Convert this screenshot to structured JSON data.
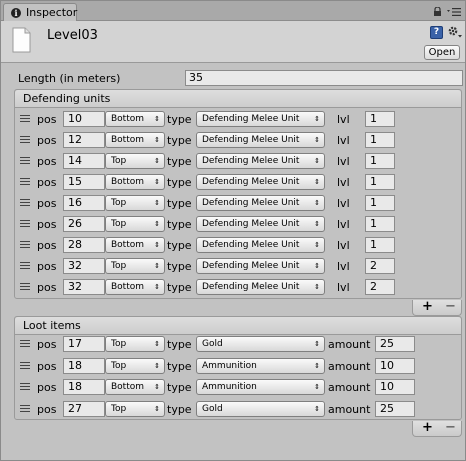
{
  "tab": {
    "label": "Inspector"
  },
  "asset": {
    "name": "Level03",
    "open_label": "Open",
    "help_glyph": "?"
  },
  "length": {
    "label": "Length (in meters)",
    "value": "35"
  },
  "defending": {
    "title": "Defending units",
    "pos_label": "pos",
    "type_label": "type",
    "lvl_label": "lvl",
    "rows": [
      {
        "pos": "10",
        "side": "Bottom",
        "type": "Defending Melee Unit",
        "lvl": "1"
      },
      {
        "pos": "12",
        "side": "Bottom",
        "type": "Defending Melee Unit",
        "lvl": "1"
      },
      {
        "pos": "14",
        "side": "Top",
        "type": "Defending Melee Unit",
        "lvl": "1"
      },
      {
        "pos": "15",
        "side": "Bottom",
        "type": "Defending Melee Unit",
        "lvl": "1"
      },
      {
        "pos": "16",
        "side": "Top",
        "type": "Defending Melee Unit",
        "lvl": "1"
      },
      {
        "pos": "26",
        "side": "Top",
        "type": "Defending Melee Unit",
        "lvl": "1"
      },
      {
        "pos": "28",
        "side": "Bottom",
        "type": "Defending Melee Unit",
        "lvl": "1"
      },
      {
        "pos": "32",
        "side": "Top",
        "type": "Defending Melee Unit",
        "lvl": "2"
      },
      {
        "pos": "32",
        "side": "Bottom",
        "type": "Defending Melee Unit",
        "lvl": "2"
      }
    ]
  },
  "loot": {
    "title": "Loot items",
    "pos_label": "pos",
    "type_label": "type",
    "amount_label": "amount",
    "rows": [
      {
        "pos": "17",
        "side": "Top",
        "type": "Gold",
        "amount": "25"
      },
      {
        "pos": "18",
        "side": "Top",
        "type": "Ammunition",
        "amount": "10"
      },
      {
        "pos": "18",
        "side": "Bottom",
        "type": "Ammunition",
        "amount": "10"
      },
      {
        "pos": "27",
        "side": "Top",
        "type": "Gold",
        "amount": "25"
      }
    ]
  },
  "list_controls": {
    "add": "+",
    "remove": "−"
  },
  "icons": [
    "info-icon",
    "lock-icon",
    "menu-icon",
    "document-icon",
    "help-icon",
    "settings-icon",
    "drag-handle-icon",
    "dropdown-arrow-icon"
  ],
  "colors": {
    "background": "#c2c2c2",
    "field": "#e9e9e9",
    "help_blue": "#3a62a8"
  }
}
